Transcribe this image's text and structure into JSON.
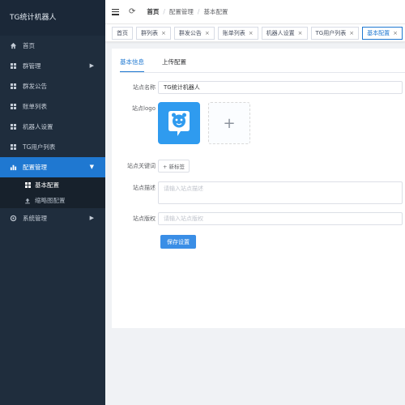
{
  "app": {
    "title": "TG统计机器人"
  },
  "sidebar": {
    "items": [
      {
        "label": "首页"
      },
      {
        "label": "群管理"
      },
      {
        "label": "群发公告"
      },
      {
        "label": "账单列表"
      },
      {
        "label": "机器人设置"
      },
      {
        "label": "TG用户列表"
      },
      {
        "label": "配置管理"
      },
      {
        "label": "系统管理"
      }
    ],
    "submenu": [
      {
        "label": "基本配置"
      },
      {
        "label": "缩略图配置"
      }
    ]
  },
  "header": {
    "breadcrumb": [
      "首页",
      "配置管理",
      "基本配置"
    ],
    "separator": "/"
  },
  "tabs": [
    {
      "label": "首页"
    },
    {
      "label": "群列表"
    },
    {
      "label": "群发公告"
    },
    {
      "label": "账单列表"
    },
    {
      "label": "机器人设置"
    },
    {
      "label": "TG用户列表"
    },
    {
      "label": "基本配置"
    }
  ],
  "content": {
    "tabs": [
      {
        "label": "基本信息"
      },
      {
        "label": "上传配置"
      }
    ],
    "form": {
      "site_name": {
        "label": "站点名称",
        "value": "TG统计机器人"
      },
      "site_logo": {
        "label": "站点logo",
        "upload_symbol": "+"
      },
      "site_keywords": {
        "label": "站点关键词",
        "button": "+ 新标签"
      },
      "site_description": {
        "label": "站点描述",
        "placeholder": "请输入站点描述"
      },
      "site_copyright": {
        "label": "站点版权",
        "placeholder": "请输入站点版权"
      },
      "save_button": "保存设置"
    }
  },
  "colors": {
    "sidebar_bg": "#1f2d3d",
    "accent": "#1f78d1",
    "logo_bg": "#2f9bef"
  }
}
